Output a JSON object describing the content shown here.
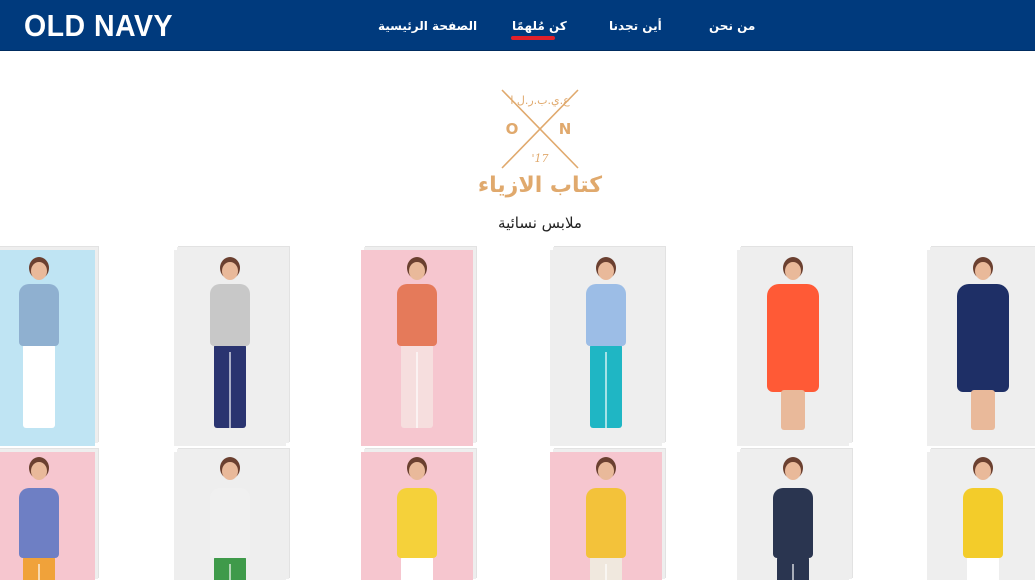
{
  "header": {
    "logo": "OLD NAVY",
    "nav": {
      "home": "الصفحة الرئيسية",
      "get_inspired": "كن مُلهمًا",
      "where_to_find_us": "أين تجدنا",
      "about_us": "من نحن"
    },
    "active_tab": "get_inspired"
  },
  "emblem": {
    "arc_text": "ع.ي.ب.ر.ل.ا",
    "letters": [
      "O",
      "N"
    ],
    "year": "'17",
    "title": "كتاب الازياء"
  },
  "section": {
    "subtitle": "ملابس نسائية"
  },
  "colors": {
    "header_bg": "#003a7d",
    "active_indicator": "#e0202a",
    "emblem": "#e0a96d"
  },
  "products": [
    {
      "bg": "#bfe4f3",
      "top": "#8fb0d0",
      "bottom": "#ffffff"
    },
    {
      "bg": "#eeeeee",
      "top": "#c8c8c8",
      "bottom": "#2a3470"
    },
    {
      "bg": "#f6c6cf",
      "top": "#e57a5a",
      "bottom": "#f6dede"
    },
    {
      "bg": "#eeeeee",
      "top": "#9cbde6",
      "bottom": "#1fb6c4"
    },
    {
      "bg": "#eeeeee",
      "top": "#ff5a36",
      "bottom": "dress"
    },
    {
      "bg": "#eeeeee",
      "top": "#1e2f66",
      "bottom": "dress"
    },
    {
      "bg": "#f6c6cf",
      "top": "#6e7fc4",
      "bottom": "#f0a23a"
    },
    {
      "bg": "#eeeeee",
      "top": "#f0f0f0",
      "bottom": "#3f9a4a"
    },
    {
      "bg": "#f6c6cf",
      "top": "#f5d13a",
      "bottom": "#ffffff"
    },
    {
      "bg": "#f6c6cf",
      "top": "#f3c23a",
      "bottom": "#f0e8de"
    },
    {
      "bg": "#eeeeee",
      "top": "#2a3550",
      "bottom": "#2a3550"
    },
    {
      "bg": "#eeeeee",
      "top": "#f3cc2a",
      "bottom": "#ffffff"
    }
  ]
}
